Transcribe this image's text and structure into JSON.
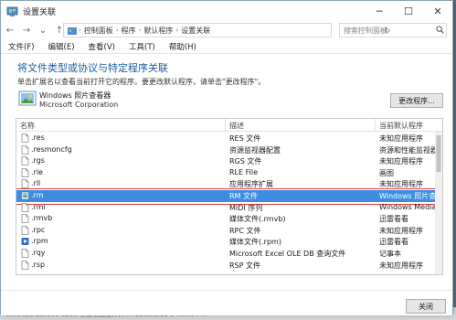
{
  "window": {
    "title": "设置关联",
    "min_glyph": "─",
    "max_glyph": "☐",
    "close_glyph": "✕",
    "icon": "control-panel-icon"
  },
  "nav": {
    "back_glyph": "←",
    "forward_glyph": "→",
    "up_glyph": "↑",
    "dropdown_glyph": "⌄",
    "refresh_glyph": "↻",
    "breadcrumbs": [
      "控制面板",
      "程序",
      "默认程序",
      "设置关联"
    ],
    "separator": "›",
    "search_placeholder": "搜索控制面板",
    "search_icon": "search-icon"
  },
  "menu": [
    "文件(F)",
    "编辑(E)",
    "查看(V)",
    "工具(T)",
    "帮助(H)"
  ],
  "main": {
    "heading": "将文件类型或协议与特定程序关联",
    "description": "单击扩展名以查看当前打开它的程序。要更改默认程序，请单击\"更改程序\"。",
    "program_name": "Windows 照片查看器",
    "program_company": "Microsoft Corporation",
    "change_button": "更改程序..."
  },
  "table": {
    "columns": [
      "名称",
      "描述",
      "当前默认程序"
    ],
    "rows": [
      {
        "ext": ".res",
        "desc": "RES 文件",
        "prog": "未知应用程序",
        "icon": "file-icon"
      },
      {
        "ext": ".resmoncfg",
        "desc": "资源监视器配置",
        "prog": "资源和性能监视器",
        "icon": "file-icon"
      },
      {
        "ext": ".rgs",
        "desc": "RGS 文件",
        "prog": "未知应用程序",
        "icon": "file-icon"
      },
      {
        "ext": ".rle",
        "desc": "RLE File",
        "prog": "画图",
        "icon": "file-icon"
      },
      {
        "ext": ".rll",
        "desc": "应用程序扩展",
        "prog": "未知应用程序",
        "icon": "file-icon"
      },
      {
        "ext": ".rm",
        "desc": "RM 文件",
        "prog": "Windows 照片查看",
        "icon": "image-file-icon",
        "selected": true
      },
      {
        "ext": ".rmi",
        "desc": "MIDI 序列",
        "prog": "Windows Media I",
        "icon": "file-icon"
      },
      {
        "ext": ".rmvb",
        "desc": "媒体文件(.rmvb)",
        "prog": "迅雷看看",
        "icon": "file-icon"
      },
      {
        "ext": ".rpc",
        "desc": "RPC 文件",
        "prog": "未知应用程序",
        "icon": "file-icon"
      },
      {
        "ext": ".rpm",
        "desc": "媒体文件(.rpm)",
        "prog": "迅雷看看",
        "icon": "media-file-icon"
      },
      {
        "ext": ".rqy",
        "desc": "Microsoft Excel OLE DB 查询文件",
        "prog": "记事本",
        "icon": "file-icon"
      },
      {
        "ext": ".rsp",
        "desc": "RSP 文件",
        "prog": "未知应用程序",
        "icon": "file-icon"
      }
    ]
  },
  "footer": {
    "close_button": "关闭"
  },
  "background_strip": "0x00025   Lenovo C300 全能电脑组件(.)   ...   2015/1/11 14:59:04   ..."
}
